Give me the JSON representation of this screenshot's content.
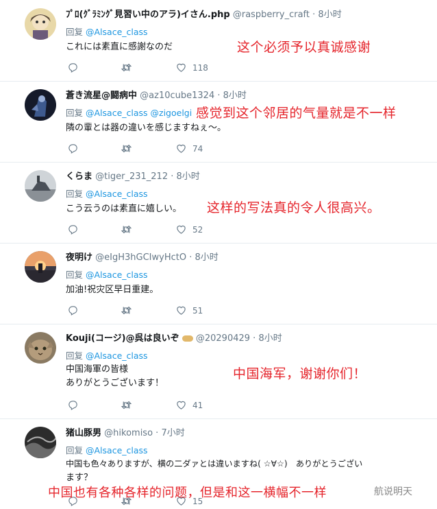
{
  "reply_label": "回复",
  "tweets": [
    {
      "name": "ﾌﾟﾛ(ｸﾞﾗﾐﾝｸﾞ見習い中のアラ)イさん.php",
      "handle": "@raspberry_craft",
      "time": "8小时",
      "mentions": "@Alsace_class",
      "text1": "これには素直に感謝なのだ",
      "text2": "",
      "reply_count": "",
      "rt_count": "",
      "like_count": "118",
      "overlay": "这个必须予以真诚感谢"
    },
    {
      "name": "蒼き流星@闘病中",
      "handle": "@az10cube1324",
      "time": "8小时",
      "mentions": "@Alsace_class @zigoelgi",
      "text1": "隣の輩とは器の違いを感じますねぇ～。",
      "text2": "",
      "reply_count": "",
      "rt_count": "",
      "like_count": "74",
      "overlay": "感觉到这个邻居的气量就是不一样"
    },
    {
      "name": "くらま",
      "handle": "@tiger_231_212",
      "time": "8小时",
      "mentions": "@Alsace_class",
      "text1": "こう云うのは素直に嬉しい。",
      "text2": "",
      "reply_count": "",
      "rt_count": "",
      "like_count": "52",
      "overlay": "这样的写法真的令人很高兴。"
    },
    {
      "name": "夜明け",
      "handle": "@eIgH3hGCIwyHctO",
      "time": "8小时",
      "mentions": "@Alsace_class",
      "text1": "加油!祝灾区早日重建。",
      "text2": "",
      "reply_count": "",
      "rt_count": "",
      "like_count": "51",
      "overlay": ""
    },
    {
      "name": "Kouji(コージ)@呉は良いぞ",
      "handle": "@20290429",
      "time": "8小时",
      "mentions": "@Alsace_class",
      "text1": "中国海軍の皆様",
      "text2": "ありがとうございます！",
      "reply_count": "",
      "rt_count": "",
      "like_count": "41",
      "overlay": "中国海军，谢谢你们！"
    },
    {
      "name": "猪山豚男",
      "handle": "@hikomiso",
      "time": "7小时",
      "mentions": "@Alsace_class",
      "text1": "中国も色々ありますが、横の二ダァとは違いますね( ☆∀☆)　ありがとうござい",
      "text2": "ます？",
      "reply_count": "",
      "rt_count": "",
      "like_count": "15",
      "overlay": "中国也有各种各样的问题，但是和这一横幅不一样"
    }
  ],
  "watermark": "航说明天",
  "colors": {
    "mention": "#1b95e0",
    "overlay_red": "#e5242b",
    "muted": "#657786"
  }
}
